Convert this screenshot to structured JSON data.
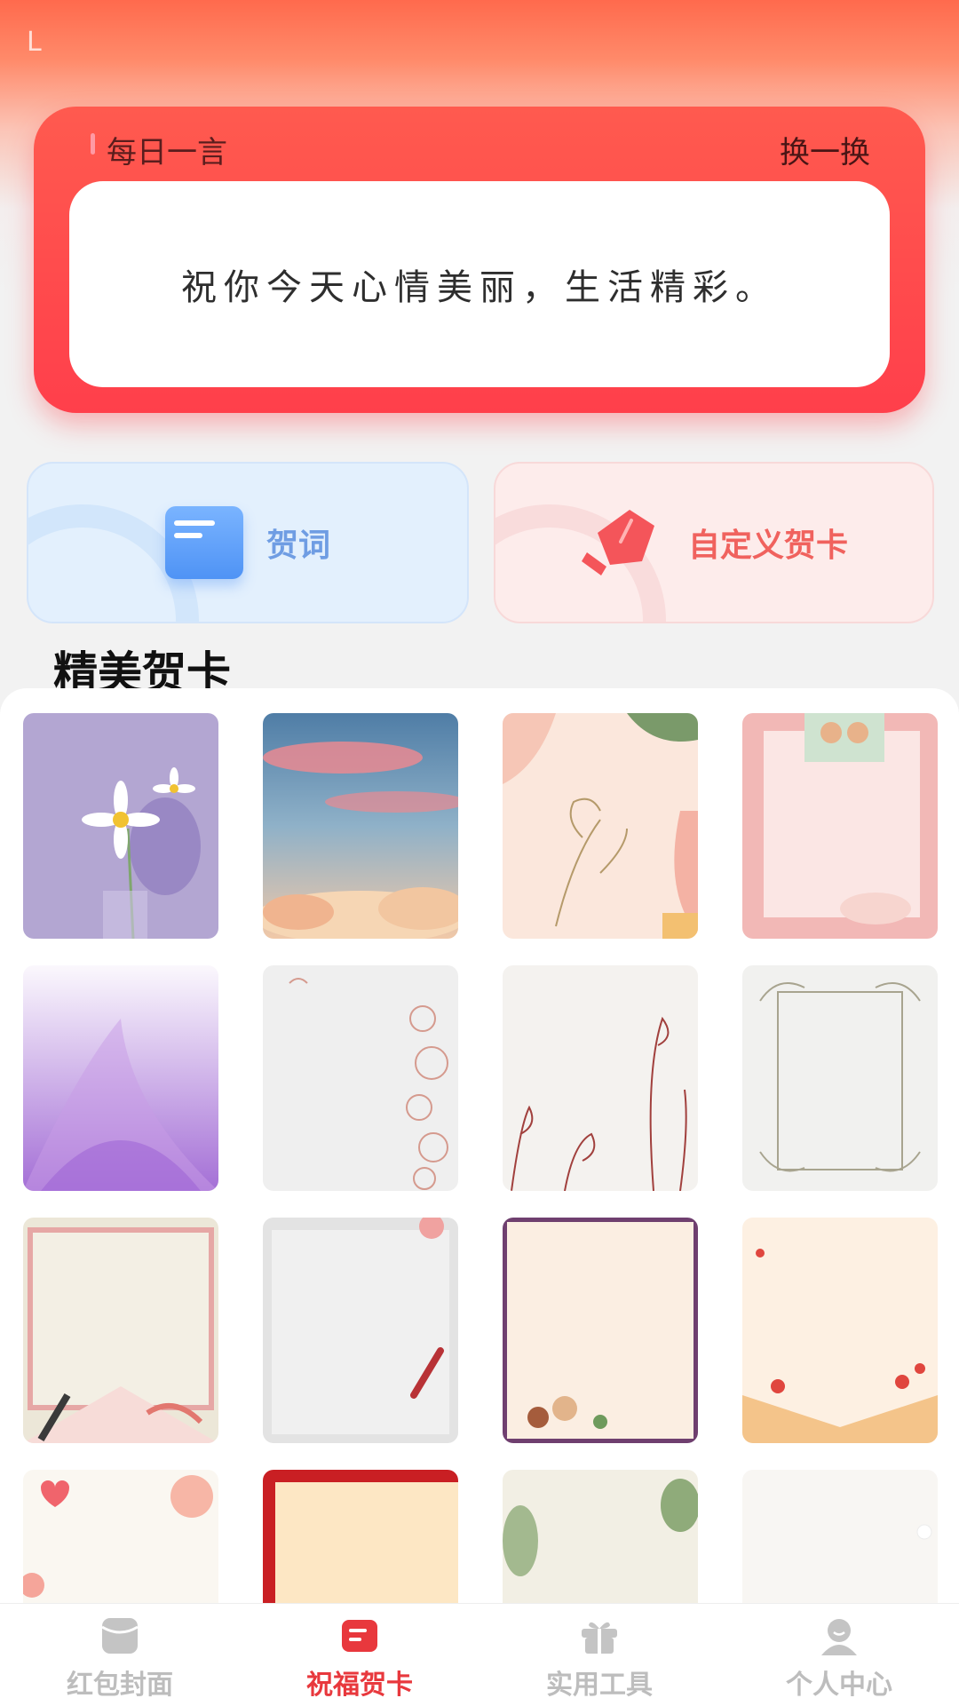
{
  "status_bar": {
    "mark": "L"
  },
  "daily_quote": {
    "title": "每日一言",
    "refresh_label": "换一换",
    "text": "祝你今天心情美丽，生活精彩。"
  },
  "features": [
    {
      "label": "贺词",
      "icon": "document-icon"
    },
    {
      "label": "自定义贺卡",
      "icon": "pen-icon"
    }
  ],
  "section_title": "精美贺卡",
  "colors": {
    "accent": "#e8383d",
    "quote_card": "#ff4a4d",
    "inactive_nav": "#bdbdbd"
  },
  "bottom_nav": [
    {
      "label": "红包封面",
      "icon": "envelope-icon",
      "active": false
    },
    {
      "label": "祝福贺卡",
      "icon": "card-icon",
      "active": true
    },
    {
      "label": "实用工具",
      "icon": "gift-icon",
      "active": false
    },
    {
      "label": "个人中心",
      "icon": "person-icon",
      "active": false
    }
  ]
}
